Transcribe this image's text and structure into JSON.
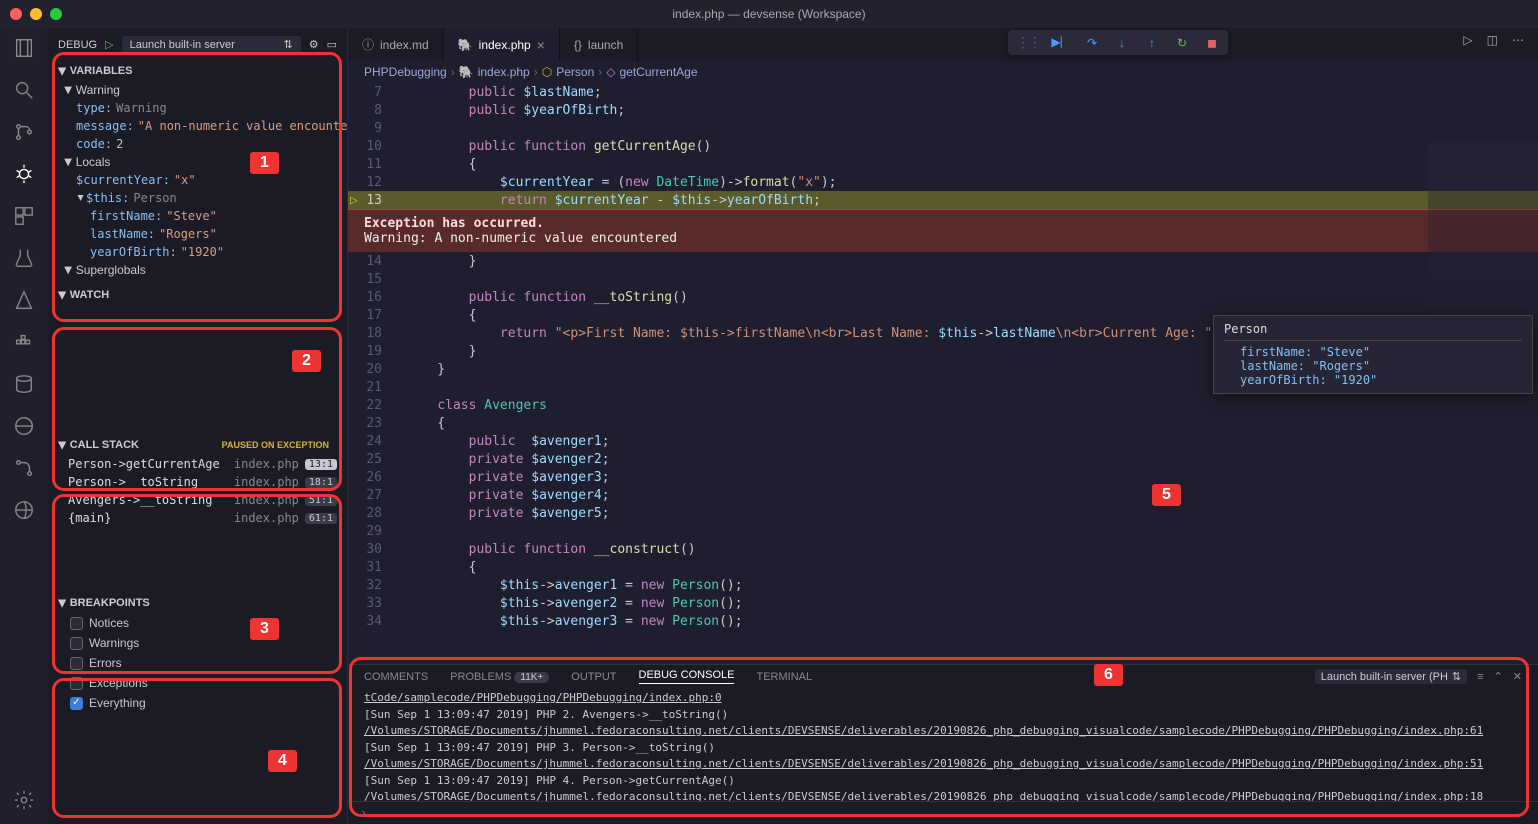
{
  "window": {
    "title": "index.php — devsense (Workspace)"
  },
  "debug": {
    "label": "DEBUG",
    "config": "Launch built-in server"
  },
  "variables": {
    "title": "VARIABLES",
    "scopes": [
      {
        "name": "Warning"
      },
      {
        "name": "Locals"
      },
      {
        "name": "Superglobals"
      }
    ],
    "warning": {
      "type_k": "type:",
      "type_v": "Warning",
      "msg_k": "message:",
      "msg_v": "\"A non-numeric value encounte…",
      "code_k": "code:",
      "code_v": "2"
    },
    "locals": {
      "curYear_k": "$currentYear:",
      "curYear_v": "\"x\"",
      "this_k": "$this:",
      "this_t": "Person",
      "fn_k": "firstName:",
      "fn_v": "\"Steve\"",
      "ln_k": "lastName:",
      "ln_v": "\"Rogers\"",
      "yob_k": "yearOfBirth:",
      "yob_v": "\"1920\""
    }
  },
  "watch": {
    "title": "WATCH"
  },
  "callstack": {
    "title": "CALL STACK",
    "status": "PAUSED ON EXCEPTION",
    "rows": [
      {
        "name": "Person->getCurrentAge",
        "file": "index.php",
        "loc": "13:1",
        "hl": true
      },
      {
        "name": "Person->__toString",
        "file": "index.php",
        "loc": "18:1"
      },
      {
        "name": "Avengers->__toString",
        "file": "index.php",
        "loc": "51:1"
      },
      {
        "name": "{main}",
        "file": "index.php",
        "loc": "61:1"
      }
    ]
  },
  "breakpoints": {
    "title": "BREAKPOINTS",
    "items": [
      {
        "label": "Notices",
        "checked": false
      },
      {
        "label": "Warnings",
        "checked": false
      },
      {
        "label": "Errors",
        "checked": false
      },
      {
        "label": "Exceptions",
        "checked": false
      },
      {
        "label": "Everything",
        "checked": true
      }
    ]
  },
  "tabs": [
    {
      "icon": "ⓘ",
      "label": "index.md",
      "active": false
    },
    {
      "icon": "🐘",
      "label": "index.php",
      "active": true
    },
    {
      "icon": "{}",
      "label": "launch",
      "active": false,
      "trunc": true
    }
  ],
  "breadcrumb": [
    "PHPDebugging",
    "index.php",
    "Person",
    "getCurrentAge"
  ],
  "exception": {
    "header": "Exception has occurred.",
    "body": "Warning: A non-numeric value encountered"
  },
  "hover": {
    "header": "Person",
    "fn": "firstName: \"Steve\"",
    "ln": "lastName: \"Rogers\"",
    "yob": "yearOfBirth: \"1920\""
  },
  "panel": {
    "tabs": {
      "comments": "COMMENTS",
      "problems": "PROBLEMS",
      "problems_badge": "11K+",
      "output": "OUTPUT",
      "debug": "DEBUG CONSOLE",
      "terminal": "TERMINAL"
    },
    "selector": "Launch built-in server (PH",
    "lines": [
      "tCode/samplecode/PHPDebugging/PHPDebugging/index.php:0",
      "[Sun Sep  1 13:09:47 2019] PHP   2. Avengers->__toString() /Volumes/STORAGE/Documents/jhummel.fedoraconsulting.net/clients/DEVSENSE/deliverables/20190826_php_debugging_visualcode/samplecode/PHPDebugging/PHPDebugging/index.php:61",
      "[Sun Sep  1 13:09:47 2019] PHP   3. Person->__toString() /Volumes/STORAGE/Documents/jhummel.fedoraconsulting.net/clients/DEVSENSE/deliverables/20190826_php_debugging_visualcode/samplecode/PHPDebugging/PHPDebugging/index.php:51",
      "[Sun Sep  1 13:09:47 2019] PHP   4. Person->getCurrentAge() /Volumes/STORAGE/Documents/jhummel.fedoraconsulting.net/clients/DEVSENSE/deliverables/20190826_php_debugging_visualcode/samplecode/PHPDebugging/PHPDebugging/index.php:18"
    ]
  },
  "annotations": [
    "1",
    "2",
    "3",
    "4",
    "5",
    "6"
  ],
  "code": {
    "lines": [
      {
        "n": 7,
        "html": "        <span class='kw'>public</span> <span class='var'>$lastName</span>;"
      },
      {
        "n": 8,
        "html": "        <span class='kw'>public</span> <span class='var'>$yearOfBirth</span>;"
      },
      {
        "n": 9,
        "html": ""
      },
      {
        "n": 10,
        "html": "        <span class='kw'>public function</span> <span class='fn'>getCurrentAge</span>()"
      },
      {
        "n": 11,
        "html": "        {"
      },
      {
        "n": 12,
        "html": "            <span class='var'>$currentYear</span> = (<span class='kw'>new</span> <span class='cls'>DateTime</span>)-><span class='fn'>format</span>(<span class='str'>\"x\"</span>);"
      },
      {
        "n": 13,
        "html": "            <span class='kw'>return</span> <span class='var'>$currentYear</span> - <span class='var'>$this</span>-><span class='var'>yearOfBirth</span>;",
        "exec": true
      }
    ],
    "after": [
      {
        "n": 14,
        "html": "        }"
      },
      {
        "n": 15,
        "html": ""
      },
      {
        "n": 16,
        "html": "        <span class='kw'>public function</span> <span class='fn'>__toString</span>()"
      },
      {
        "n": 17,
        "html": "        {"
      },
      {
        "n": 18,
        "html": "            <span class='kw'>return</span> <span class='str'>\"&lt;p&gt;First Name: $this-&gt;firstName\\n&lt;br&gt;Last Name: </span><span class='var'>$this</span>-&gt;<span class='var'>lastName</span><span class='str'>\\n&lt;br&gt;Current Age: \"</span>.<span class='var'>$this</span>-><span class='fn'>getCurrentAge</span>().<span class='str'>\"&lt;/p&gt;\"</span>;"
      },
      {
        "n": 19,
        "html": "        }"
      },
      {
        "n": 20,
        "html": "    }"
      },
      {
        "n": 21,
        "html": ""
      },
      {
        "n": 22,
        "html": "    <span class='kw'>class</span> <span class='cls'>Avengers</span>"
      },
      {
        "n": 23,
        "html": "    {"
      },
      {
        "n": 24,
        "html": "        <span class='kw'>public</span>  <span class='var'>$avenger1</span>;"
      },
      {
        "n": 25,
        "html": "        <span class='kw'>private</span> <span class='var'>$avenger2</span>;"
      },
      {
        "n": 26,
        "html": "        <span class='kw'>private</span> <span class='var'>$avenger3</span>;"
      },
      {
        "n": 27,
        "html": "        <span class='kw'>private</span> <span class='var'>$avenger4</span>;"
      },
      {
        "n": 28,
        "html": "        <span class='kw'>private</span> <span class='var'>$avenger5</span>;"
      },
      {
        "n": 29,
        "html": ""
      },
      {
        "n": 30,
        "html": "        <span class='kw'>public function</span> <span class='fn'>__construct</span>()"
      },
      {
        "n": 31,
        "html": "        {"
      },
      {
        "n": 32,
        "html": "            <span class='var'>$this</span>-><span class='var'>avenger1</span> = <span class='kw'>new</span> <span class='cls'>Person</span>();"
      },
      {
        "n": 33,
        "html": "            <span class='var'>$this</span>-><span class='var'>avenger2</span> = <span class='kw'>new</span> <span class='cls'>Person</span>();"
      },
      {
        "n": 34,
        "html": "            <span class='var'>$this</span>-><span class='var'>avenger3</span> = <span class='kw'>new</span> <span class='cls'>Person</span>();"
      }
    ]
  }
}
